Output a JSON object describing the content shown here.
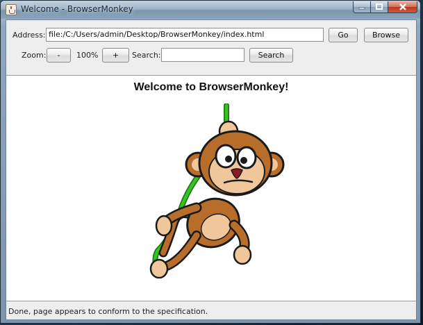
{
  "window": {
    "title": "Welcome - BrowserMonkey"
  },
  "toolbar": {
    "address_label": "Address:",
    "address_value": "file:/C:/Users/admin/Desktop/BrowserMonkey/index.html",
    "go_label": "Go",
    "browse_label": "Browse",
    "zoom_label": "Zoom:",
    "zoom_out_label": "-",
    "zoom_value": "100%",
    "zoom_in_label": "+",
    "search_label": "Search:",
    "search_value": "",
    "search_button_label": "Search"
  },
  "content": {
    "heading": "Welcome to BrowserMonkey!",
    "image": "cartoon-monkey-on-vine"
  },
  "status": {
    "text": "Done, page appears to conform to the specification."
  },
  "colors": {
    "vine": "#27b01c",
    "monkey_fur": "#b86e2a",
    "monkey_face": "#f0c79a"
  }
}
